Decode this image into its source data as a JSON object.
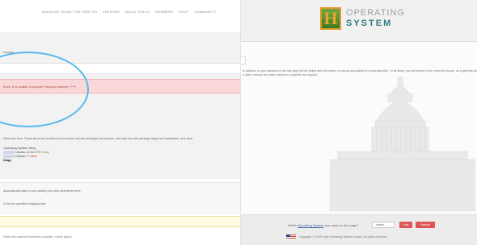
{
  "left": {
    "nav_links": [
      "Building Guide for Gentoo",
      "Lessons",
      "Build Skills",
      "Members",
      "Help",
      "Community"
    ],
    "panel_title": "Lesson",
    "alert_text": "Error: It is unable to acquire Principal number: (***)",
    "description": "Select the item. These items are provided by the owner, include prototype and lessons, and may use with package target and destination, and other.",
    "info_heading": "Operating System Story",
    "info_row1_label": "Ubuntu 12.04 LTS",
    "info_row1_value": "Trusty",
    "info_row2_label": "Debian 7",
    "info_row2_value": "Failed",
    "info_bold": "Stage",
    "section_line1": "Automatically start in your default your best experience here.",
    "section_line2": "Or try the specified shipping note",
    "footer_note": "Verify site scanned functions a domain / useful layout."
  },
  "right": {
    "logo_top": "OPERATING",
    "logo_bottom": "SYSTEM",
    "paragraph": "In addition, in your standard it site this page will be visible and will require a manual associated of a operating title. To be listed, you will require to be correctly chosen, as it gets like as a client; choose the lower options to complete the request.",
    "question_text": "Which",
    "question_link": "Operating System",
    "question_tail": "was used on this page?",
    "select_value": "- select -",
    "vote_button": "Vote",
    "results_button": "Results",
    "copyright": "Copyright © 2015 Hold Operating System Library. All rights reserved."
  }
}
